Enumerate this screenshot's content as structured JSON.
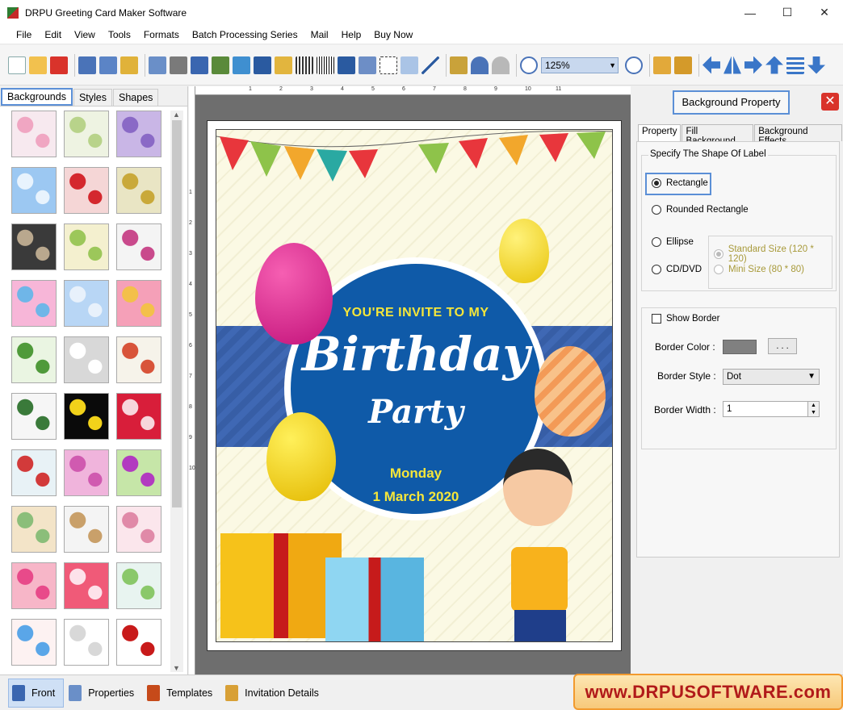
{
  "window": {
    "title": "DRPU Greeting Card Maker Software",
    "minimize": "—",
    "maximize": "☐",
    "close": "✕"
  },
  "menu": [
    "File",
    "Edit",
    "View",
    "Tools",
    "Formats",
    "Batch Processing Series",
    "Mail",
    "Help",
    "Buy Now"
  ],
  "toolbar": {
    "zoom": "125%"
  },
  "left_tabs": [
    "Backgrounds",
    "Styles",
    "Shapes"
  ],
  "card": {
    "invite": "YOU'RE INVITE TO MY",
    "title_line1": "Birthday",
    "title_line2": "Party",
    "day": "Monday",
    "date": "1 March 2020"
  },
  "ruler": {
    "h": [
      "1",
      "2",
      "3",
      "4",
      "5",
      "6",
      "7",
      "8",
      "9",
      "10",
      "11"
    ],
    "v": [
      "1",
      "2",
      "3",
      "4",
      "5",
      "6",
      "7",
      "8",
      "9",
      "10"
    ]
  },
  "right": {
    "title": "Background Property",
    "tabs": [
      "Property",
      "Fill Background",
      "Background Effects"
    ],
    "shape_group": "Specify The Shape Of Label",
    "shapes": {
      "rectangle": "Rectangle",
      "rounded": "Rounded Rectangle",
      "ellipse": "Ellipse",
      "cd": "CD/DVD"
    },
    "sizes": {
      "standard": "Standard Size (120 * 120)",
      "mini": "Mini Size (80 * 80)"
    },
    "show_border": "Show Border",
    "border_color_label": "Border Color :",
    "border_color_btn": ". . .",
    "border_style_label": "Border Style :",
    "border_style_value": "Dot",
    "border_width_label": "Border Width :",
    "border_width_value": "1",
    "border_color": "#808080"
  },
  "bottom_tabs": [
    "Front",
    "Properties",
    "Templates",
    "Invitation Details"
  ],
  "brand": "www.DRPUSOFTWARE.com"
}
